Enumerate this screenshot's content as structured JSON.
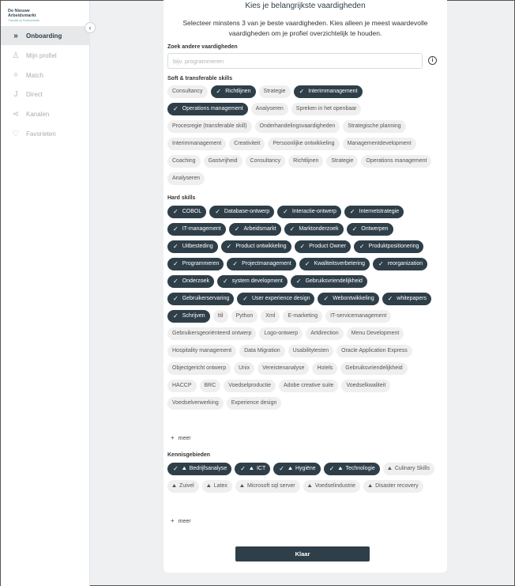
{
  "brand": {
    "line1": "De Nieuwe",
    "line2": "Arbeidsmarkt",
    "line3": "Transitie by Professionals"
  },
  "nav": [
    {
      "label": "Onboarding",
      "icon": "chevrons-right-icon",
      "glyph": "»",
      "active": true
    },
    {
      "label": "Mijn profiel",
      "icon": "user-icon",
      "glyph": "♙"
    },
    {
      "label": "Match",
      "icon": "sparkle-icon",
      "glyph": "✧"
    },
    {
      "label": "Direct",
      "icon": "direct-icon",
      "glyph": "J"
    },
    {
      "label": "Kanalen",
      "icon": "share-icon",
      "glyph": "⋖"
    },
    {
      "label": "Favorieten",
      "icon": "heart-icon",
      "glyph": "♡"
    }
  ],
  "page": {
    "title": "Kies je belangrijkste vaardigheden",
    "subtitle": "Selecteer minstens 3 van je beste vaardigheden. Kies alleen je meest waardevolle vaardigheden om je profiel overzichtelijk te houden."
  },
  "search": {
    "label": "Zoek andere vaardigheden",
    "placeholder": "bijv. programmeren",
    "value": ""
  },
  "soft": {
    "label": "Soft & transferable skills",
    "chips": [
      {
        "t": "Consultancy",
        "s": false
      },
      {
        "t": "Richtlijnen",
        "s": true
      },
      {
        "t": "Strategie",
        "s": false
      },
      {
        "t": "Interimmanagement",
        "s": true
      },
      {
        "t": "Operations management",
        "s": true
      },
      {
        "t": "Analyseren",
        "s": false
      },
      {
        "t": "Spreken in het openbaar",
        "s": false
      },
      {
        "t": "Procesregie (transferable skill)",
        "s": false
      },
      {
        "t": "Onderhandelingsvaardigheden",
        "s": false
      },
      {
        "t": "Strategische planning",
        "s": false
      },
      {
        "t": "Interimmanagement",
        "s": false
      },
      {
        "t": "Creativiteit",
        "s": false
      },
      {
        "t": "Persoonlijke ontwikkeling",
        "s": false
      },
      {
        "t": "Managementdevelopment",
        "s": false
      },
      {
        "t": "Coaching",
        "s": false
      },
      {
        "t": "Gastvrijheid",
        "s": false
      },
      {
        "t": "Consultancy",
        "s": false
      },
      {
        "t": "Richtlijnen",
        "s": false
      },
      {
        "t": "Strategie",
        "s": false
      },
      {
        "t": "Operations management",
        "s": false
      },
      {
        "t": "Analyseren",
        "s": false
      }
    ]
  },
  "hard": {
    "label": "Hard skills",
    "chips": [
      {
        "t": "COBOL",
        "s": true
      },
      {
        "t": "Database-ontwerp",
        "s": true
      },
      {
        "t": "Interactie-ontwerp",
        "s": true
      },
      {
        "t": "Internetstrategie",
        "s": true
      },
      {
        "t": "IT-management",
        "s": true
      },
      {
        "t": "Arbeidsmarkt",
        "s": true
      },
      {
        "t": "Marktonderzoek",
        "s": true
      },
      {
        "t": "Ontwerpen",
        "s": true
      },
      {
        "t": "Uitbesteding",
        "s": true
      },
      {
        "t": "Product ontwikkeling",
        "s": true
      },
      {
        "t": "Product Owner",
        "s": true
      },
      {
        "t": "Produktpositionering",
        "s": true
      },
      {
        "t": "Programmeren",
        "s": true
      },
      {
        "t": "Projectmanagement",
        "s": true
      },
      {
        "t": "Kwaliteitsverbetering",
        "s": true
      },
      {
        "t": "reorganization",
        "s": true
      },
      {
        "t": "Onderzoek",
        "s": true
      },
      {
        "t": "system development",
        "s": true
      },
      {
        "t": "Gebruiksvriendelijkheid",
        "s": true
      },
      {
        "t": "Gebruikerservaring",
        "s": true
      },
      {
        "t": "User experience design",
        "s": true
      },
      {
        "t": "Webontwikkeling",
        "s": true
      },
      {
        "t": "whitepapers",
        "s": true
      },
      {
        "t": "Schrijven",
        "s": true
      },
      {
        "t": "Itil",
        "s": false
      },
      {
        "t": "Python",
        "s": false
      },
      {
        "t": "Xml",
        "s": false
      },
      {
        "t": "E-marketing",
        "s": false
      },
      {
        "t": "IT-servicemanagement",
        "s": false
      },
      {
        "t": "Gebruikersgeoriënteerd ontwerp",
        "s": false
      },
      {
        "t": "Logo-ontwerp",
        "s": false
      },
      {
        "t": "Artdirection",
        "s": false
      },
      {
        "t": "Menu Development",
        "s": false
      },
      {
        "t": "Hospitality management",
        "s": false
      },
      {
        "t": "Data Migration",
        "s": false
      },
      {
        "t": "Usabilitytesten",
        "s": false
      },
      {
        "t": "Oracle Application Express",
        "s": false
      },
      {
        "t": "Objectgericht ontwerp",
        "s": false
      },
      {
        "t": "Unix",
        "s": false
      },
      {
        "t": "Vereistenanalyse",
        "s": false
      },
      {
        "t": "Hotels",
        "s": false
      },
      {
        "t": "Gebruiksvriendelijkheid",
        "s": false
      },
      {
        "t": "HACCP",
        "s": false
      },
      {
        "t": "BRC",
        "s": false
      },
      {
        "t": "Voedselproductie",
        "s": false
      },
      {
        "t": "Adobe creative suite",
        "s": false
      },
      {
        "t": "Voedselkwaliteit",
        "s": false
      },
      {
        "t": "Voedselverwerking",
        "s": false
      },
      {
        "t": "Experience design",
        "s": false
      }
    ],
    "more": "meer"
  },
  "knowledge": {
    "label": "Kennisgebieden",
    "chips": [
      {
        "t": "Bedrijfsanalyse",
        "s": true
      },
      {
        "t": "ICT",
        "s": true
      },
      {
        "t": "Hygiëne",
        "s": true
      },
      {
        "t": "Technologie",
        "s": true
      },
      {
        "t": "Culinary Skills",
        "s": false
      },
      {
        "t": "Zuivel",
        "s": false
      },
      {
        "t": "Latex",
        "s": false
      },
      {
        "t": "Microsoft sql server",
        "s": false
      },
      {
        "t": "Voedselindustrie",
        "s": false
      },
      {
        "t": "Disaster recovery",
        "s": false
      }
    ],
    "more": "meer"
  },
  "done_label": "Klaar",
  "colors": {
    "accent": "#2f3f49",
    "chip": "#efefef",
    "background": "#eef0f2"
  }
}
